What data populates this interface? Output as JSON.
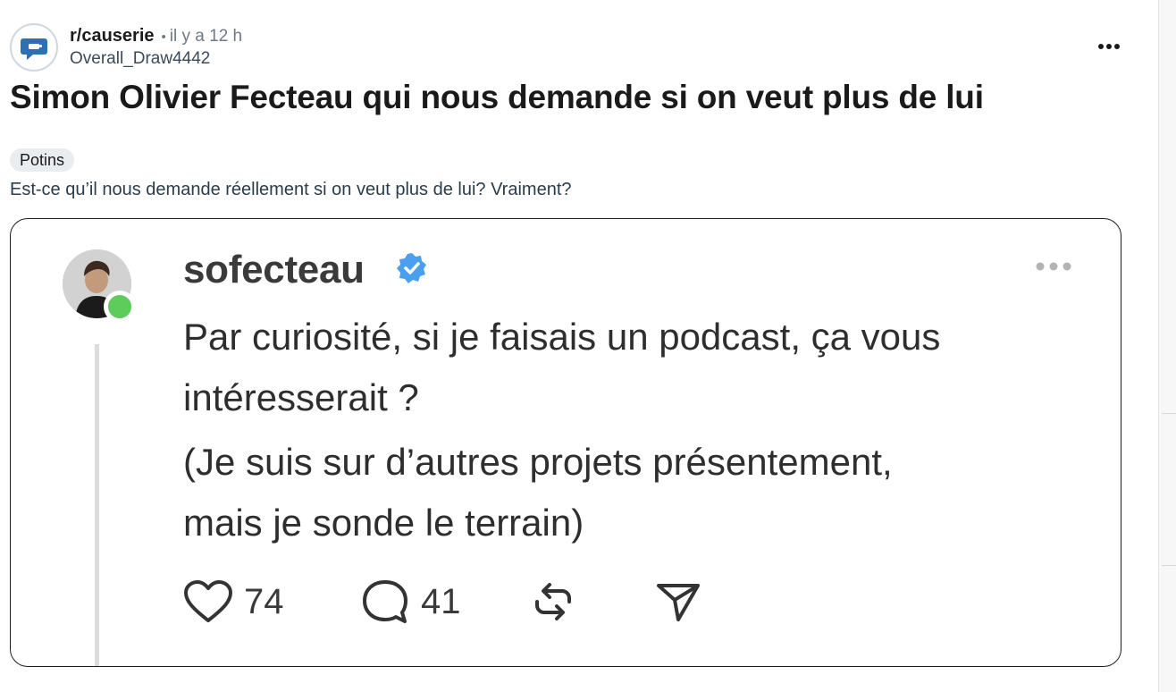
{
  "post": {
    "subreddit": "r/causerie",
    "separator": "•",
    "time": "il y a 12 h",
    "author": "Overall_Draw4442",
    "title": "Simon Olivier Fecteau qui nous demande si on veut plus de lui",
    "flair": "Potins",
    "body": "Est-ce qu’il nous demande réellement si on veut plus de lui? Vraiment?",
    "icons": {
      "subreddit": "chat-bubble-icon",
      "more": "more-horizontal-icon"
    }
  },
  "embed": {
    "username": "sofecteau",
    "verified": true,
    "lines": [
      "Par curiosité, si je faisais un podcast, ça vous",
      "intéresserait ?",
      "(Je suis sur d’autres projets présentement,",
      "mais je sonde le terrain)"
    ],
    "likes": "74",
    "comments": "41",
    "icons": [
      "heart-icon",
      "comment-icon",
      "repost-icon",
      "share-icon"
    ],
    "colors": {
      "verified": "#4a9ff0",
      "online": "#5dcc5a"
    }
  }
}
